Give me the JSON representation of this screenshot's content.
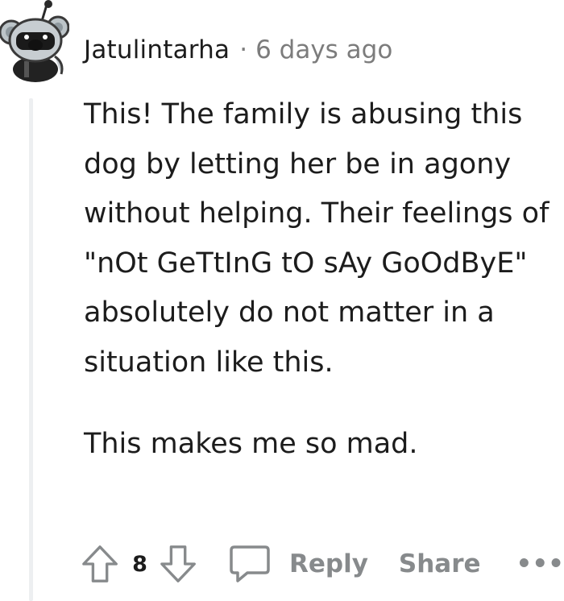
{
  "comment": {
    "author": "Jatulintarha",
    "separator": "·",
    "time_ago": "6 days ago",
    "paragraphs": [
      "This! The family is abusing this dog by letting her be in agony without helping. Their feelings of \"nOt GeTtInG tO sAy GoOdByE\" absolutely do not matter in a situation like this.",
      "This makes me so mad."
    ]
  },
  "actions": {
    "upvote_icon": "upvote-arrow-icon",
    "vote_count": "8",
    "downvote_icon": "downvote-arrow-icon",
    "reply_icon": "speech-bubble-icon",
    "reply_label": "Reply",
    "share_label": "Share",
    "more_label": "•••"
  },
  "colors": {
    "text": "#1c1c1c",
    "meta": "#7c7c7c",
    "action_gray": "#878a8c",
    "thread_line": "#edeff1"
  }
}
